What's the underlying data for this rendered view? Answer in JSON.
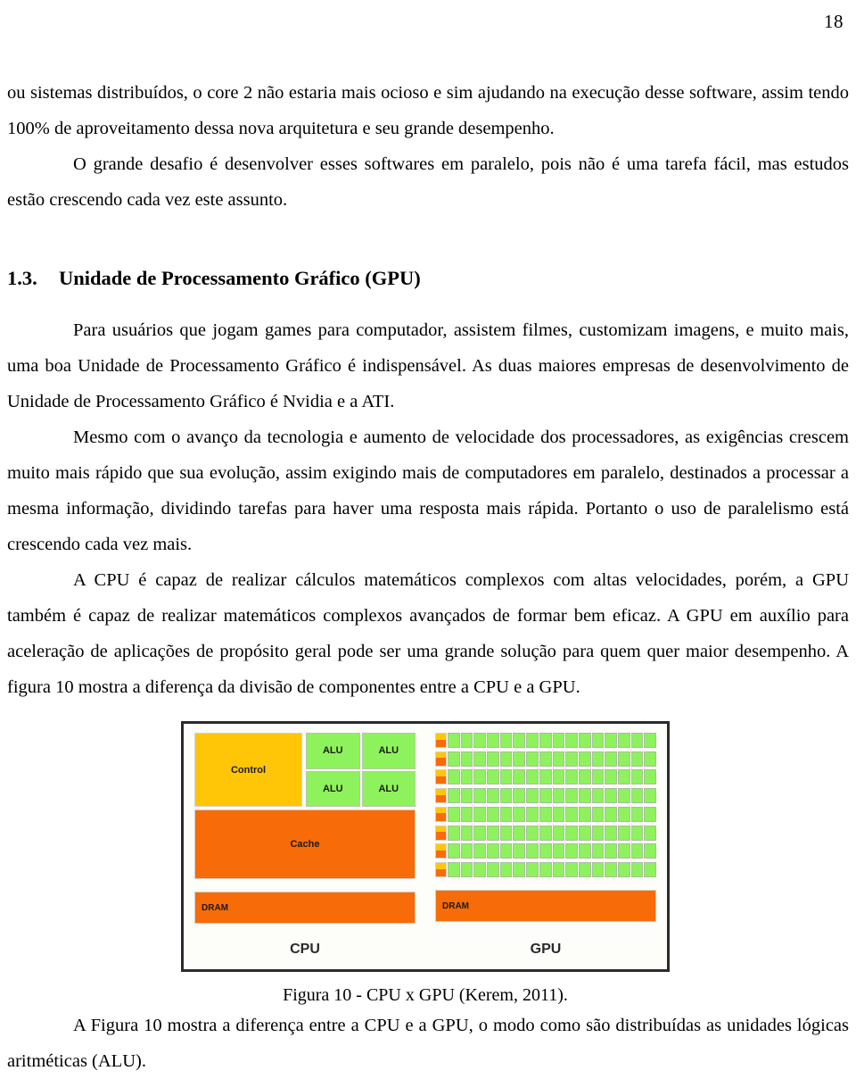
{
  "page": {
    "number": "18"
  },
  "paragraphs": {
    "p1": "ou sistemas distribuídos, o core 2 não estaria mais ocioso e sim ajudando na execução desse software, assim tendo 100% de aproveitamento dessa nova arquitetura e seu grande desempenho.",
    "p2": "O grande desafio é desenvolver esses softwares em paralelo, pois não é uma tarefa fácil, mas estudos estão crescendo cada vez este assunto.",
    "p3": "Para usuários que jogam games para computador, assistem filmes, customizam imagens, e muito mais, uma boa Unidade de Processamento Gráfico é indispensável. As duas maiores empresas de desenvolvimento de Unidade de Processamento Gráfico é Nvidia e a ATI.",
    "p4": "Mesmo com o avanço da tecnologia e aumento de velocidade dos processadores, as exigências crescem muito mais rápido que sua evolução, assim exigindo mais de computadores em paralelo, destinados a processar a mesma informação, dividindo tarefas para haver uma resposta mais rápida. Portanto o uso de paralelismo está crescendo cada vez mais.",
    "p5": "A CPU é capaz de realizar cálculos matemáticos complexos com altas velocidades, porém, a GPU também é capaz de realizar matemáticos complexos avançados de formar bem eficaz. A GPU em auxílio para aceleração de aplicações de propósito geral pode ser uma grande solução para quem quer maior desempenho. A figura 10 mostra a diferença da divisão de componentes entre a CPU e a GPU.",
    "p6": "A Figura 10 mostra a diferença entre a CPU e a GPU, o modo como são distribuídas as unidades lógicas aritméticas (ALU)."
  },
  "heading": {
    "number": "1.3.",
    "title": "Unidade de Processamento Gráfico (GPU)"
  },
  "figure": {
    "caption": "Figura 10 - CPU x GPU (Kerem, 2011).",
    "cpu": {
      "label": "CPU",
      "control": "Control",
      "alus": [
        "ALU",
        "ALU",
        "ALU",
        "ALU"
      ],
      "cache": "Cache",
      "dram": "DRAM"
    },
    "gpu": {
      "label": "GPU",
      "dram": "DRAM",
      "core_rows": 8,
      "core_columns": 16
    },
    "colors": {
      "control": "#ffc607",
      "alu": "#8ef25c",
      "cache": "#f76b08",
      "dram": "#f76b08",
      "frame": "#2b2b2b",
      "background": "#fdfdfa"
    }
  }
}
